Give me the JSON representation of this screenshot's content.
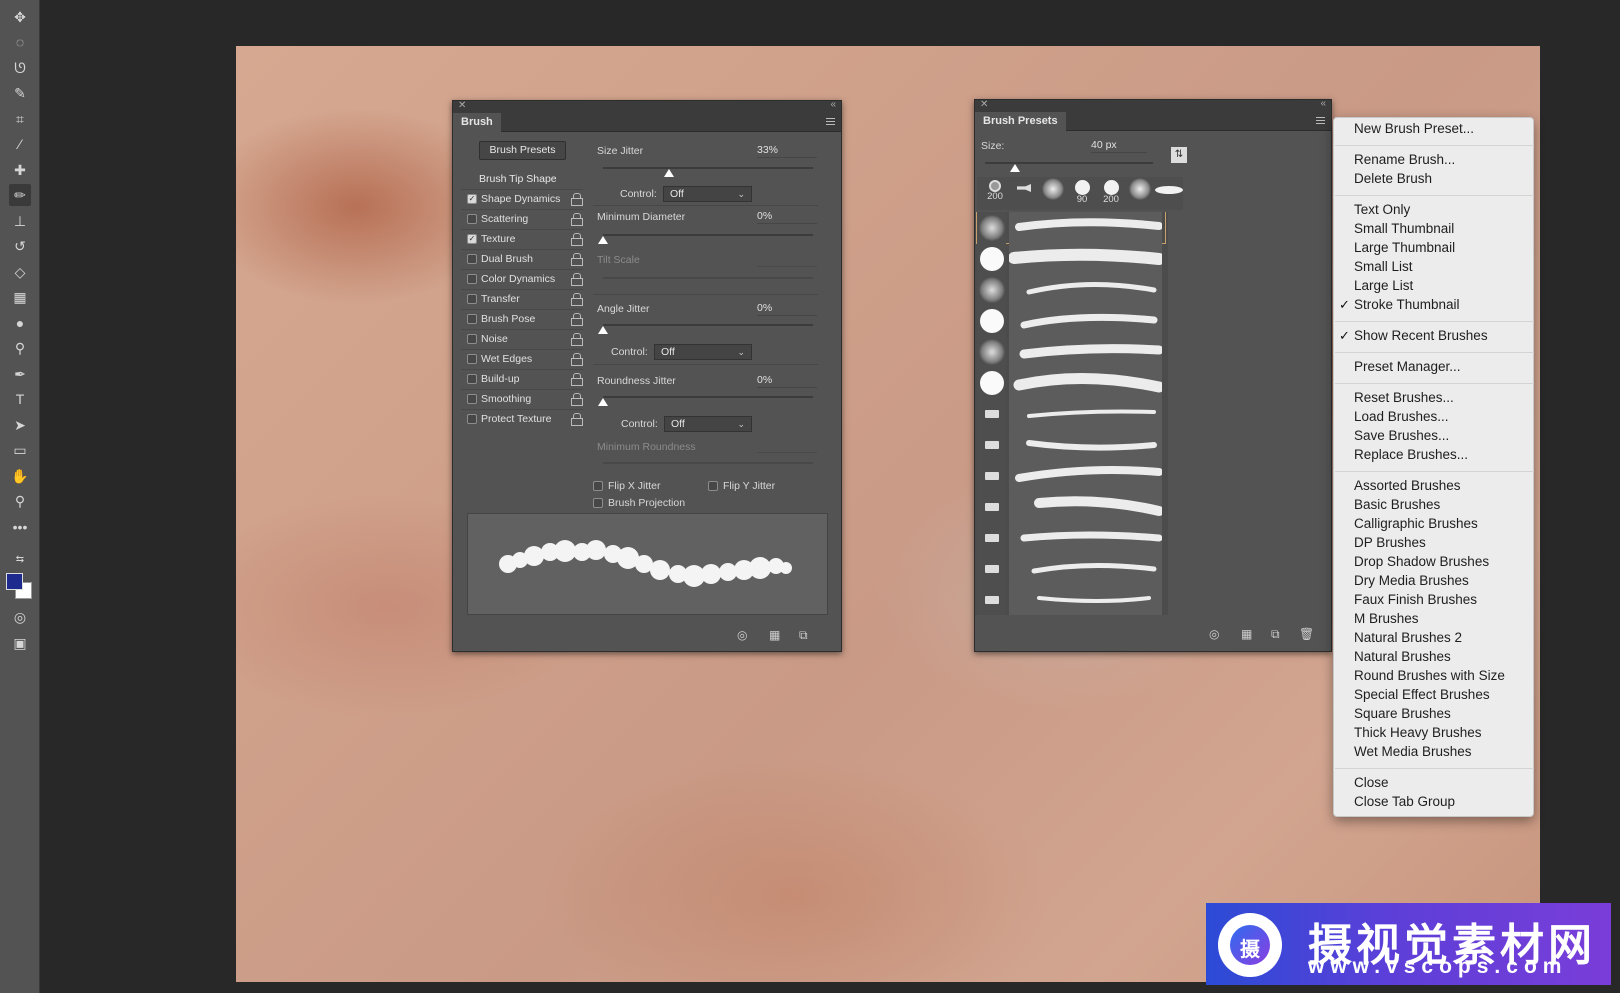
{
  "toolbar": {
    "tools": [
      "move-icon",
      "marquee-icon",
      "lasso-icon",
      "quick-select-icon",
      "crop-icon",
      "eyedropper-icon",
      "healing-icon",
      "brush-icon",
      "stamp-icon",
      "history-brush-icon",
      "eraser-icon",
      "gradient-icon",
      "blur-icon",
      "dodge-icon",
      "pen-icon",
      "type-icon",
      "path-select-icon",
      "rectangle-icon",
      "hand-icon",
      "zoom-icon",
      "more-icon"
    ],
    "foreground_color": "#1f2a8f",
    "background_color": "#ffffff"
  },
  "brush_panel": {
    "tab": "Brush",
    "presets_button": "Brush Presets",
    "tip_shape": "Brush Tip Shape",
    "options": [
      {
        "label": "Shape Dynamics",
        "checked": true
      },
      {
        "label": "Scattering",
        "checked": false
      },
      {
        "label": "Texture",
        "checked": true
      },
      {
        "label": "Dual Brush",
        "checked": false
      },
      {
        "label": "Color Dynamics",
        "checked": false
      },
      {
        "label": "Transfer",
        "checked": false
      },
      {
        "label": "Brush Pose",
        "checked": false
      },
      {
        "label": "Noise",
        "checked": false
      },
      {
        "label": "Wet Edges",
        "checked": false
      },
      {
        "label": "Build-up",
        "checked": false
      },
      {
        "label": "Smoothing",
        "checked": false
      },
      {
        "label": "Protect Texture",
        "checked": false
      }
    ],
    "size_jitter_label": "Size Jitter",
    "size_jitter_value": "33%",
    "control_label": "Control:",
    "control_value": "Off",
    "min_diameter_label": "Minimum Diameter",
    "min_diameter_value": "0%",
    "tilt_scale_label": "Tilt Scale",
    "angle_jitter_label": "Angle Jitter",
    "angle_jitter_value": "0%",
    "roundness_jitter_label": "Roundness Jitter",
    "roundness_jitter_value": "0%",
    "min_roundness_label": "Minimum Roundness",
    "flip_x": "Flip X Jitter",
    "flip_y": "Flip Y Jitter",
    "projection": "Brush Projection"
  },
  "presets_panel": {
    "tab": "Brush Presets",
    "size_label": "Size:",
    "size_value": "40 px",
    "recent_sizes": [
      "200",
      "",
      "",
      "90",
      "200",
      "",
      ""
    ]
  },
  "context_menu": {
    "new_preset": "New Brush Preset...",
    "rename": "Rename Brush...",
    "delete": "Delete Brush",
    "view_modes": [
      "Text Only",
      "Small Thumbnail",
      "Large Thumbnail",
      "Small List",
      "Large List",
      "Stroke Thumbnail"
    ],
    "show_recent": "Show Recent Brushes",
    "preset_manager": "Preset Manager...",
    "file_ops": [
      "Reset Brushes...",
      "Load Brushes...",
      "Save Brushes...",
      "Replace Brushes..."
    ],
    "libraries": [
      "Assorted Brushes",
      "Basic Brushes",
      "Calligraphic Brushes",
      "DP Brushes",
      "Drop Shadow Brushes",
      "Dry Media Brushes",
      "Faux Finish Brushes",
      "M Brushes",
      "Natural Brushes 2",
      "Natural Brushes",
      "Round Brushes with Size",
      "Special Effect Brushes",
      "Square Brushes",
      "Thick Heavy Brushes",
      "Wet Media Brushes"
    ],
    "close": "Close",
    "close_group": "Close Tab Group",
    "check_mark": "✓"
  },
  "watermark": {
    "logo_char": "摄",
    "title": "摄视觉素材网",
    "url": "www.vscops.com"
  }
}
